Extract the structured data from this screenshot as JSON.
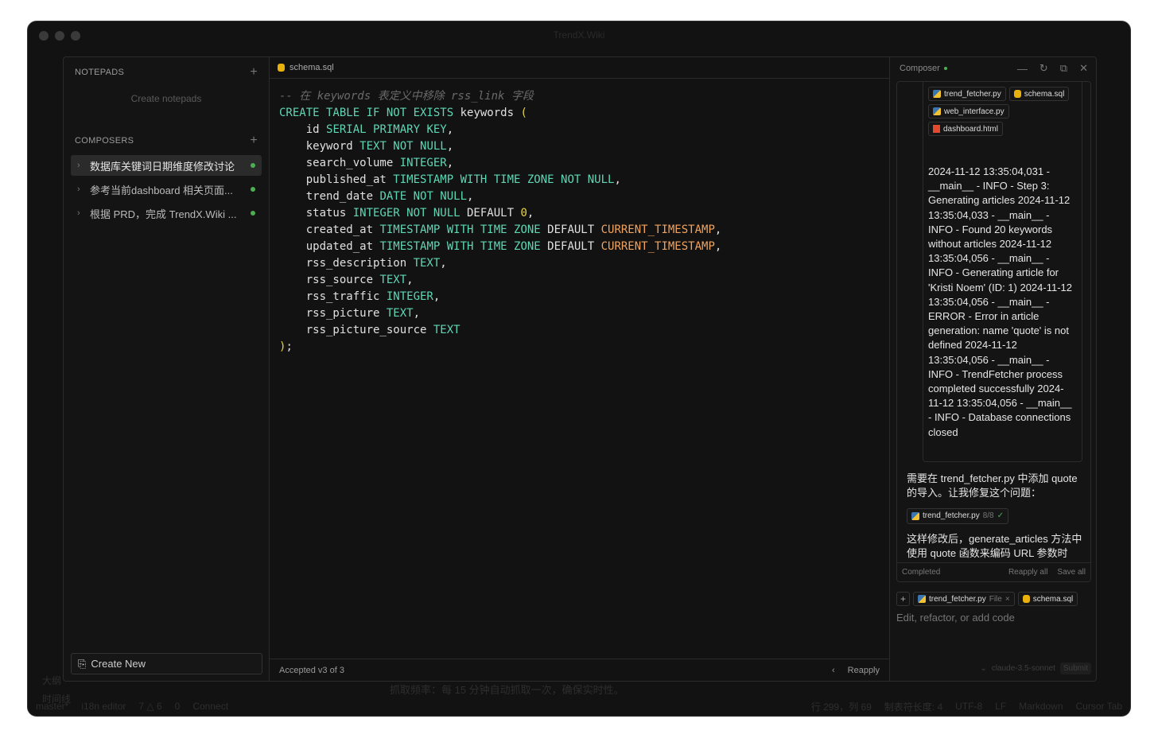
{
  "window": {
    "title": "TrendX.Wiki"
  },
  "background": {
    "outline_items": [
      "大纲",
      "时间线"
    ],
    "doc_line": "抓取频率：每 15 分钟自动抓取一次，确保实时性。"
  },
  "status_bar": {
    "branch": "master*",
    "i18n": "i18n editor",
    "problems": "7 △ 6",
    "ports": "0",
    "connect": "Connect",
    "position": "行 299，列 69",
    "tab_size": "制表符长度: 4",
    "encoding": "UTF-8",
    "eol": "LF",
    "language": "Markdown",
    "cursor_tab": "Cursor Tab"
  },
  "sidebar": {
    "notepads_header": "NOTEPADS",
    "notepads_empty": "Create notepads",
    "composers_header": "COMPOSERS",
    "composers": [
      {
        "label": "数据库关键词日期维度修改讨论",
        "active": true
      },
      {
        "label": "参考当前dashboard 相关页面...",
        "active": false
      },
      {
        "label": "根据 PRD，完成 TrendX.Wiki ...",
        "active": false
      }
    ],
    "create_new": "Create New"
  },
  "editor": {
    "tab": "schema.sql",
    "comment": "-- 在 keywords 表定义中移除 rss_link 字段",
    "footer_status": "Accepted v3 of 3",
    "reapply": "Reapply"
  },
  "composer": {
    "title": "Composer",
    "files": [
      "trend_fetcher.py",
      "schema.sql",
      "web_interface.py",
      "dashboard.html"
    ],
    "log": "2024-11-12 13:35:04,031 - __main__ - INFO - Step 3: Generating articles 2024-11-12 13:35:04,033 - __main__ - INFO - Found 20 keywords without articles 2024-11-12 13:35:04,056 - __main__ - INFO - Generating article for 'Kristi Noem' (ID: 1) 2024-11-12 13:35:04,056 - __main__ - ERROR - Error in article generation: name 'quote' is not defined 2024-11-12 13:35:04,056 - __main__ - INFO - TrendFetcher process completed successfully 2024-11-12 13:35:04,056 - __main__ - INFO - Database connections closed",
    "reply1": "需要在 trend_fetcher.py 中添加 quote 的导入。让我修复这个问题：",
    "edit_chip": {
      "file": "trend_fetcher.py",
      "progress": "8/8"
    },
    "reply2": "这样修改后，generate_articles 方法中使用 quote 函数来编码 URL 参数时",
    "state": "Completed",
    "reapply_all": "Reapply all",
    "save_all": "Save all",
    "context": [
      {
        "file": "trend_fetcher.py",
        "tag": "File"
      },
      {
        "file": "schema.sql"
      }
    ],
    "placeholder": "Edit, refactor, or add code",
    "model": "claude-3.5-sonnet",
    "submit": "Submit"
  }
}
